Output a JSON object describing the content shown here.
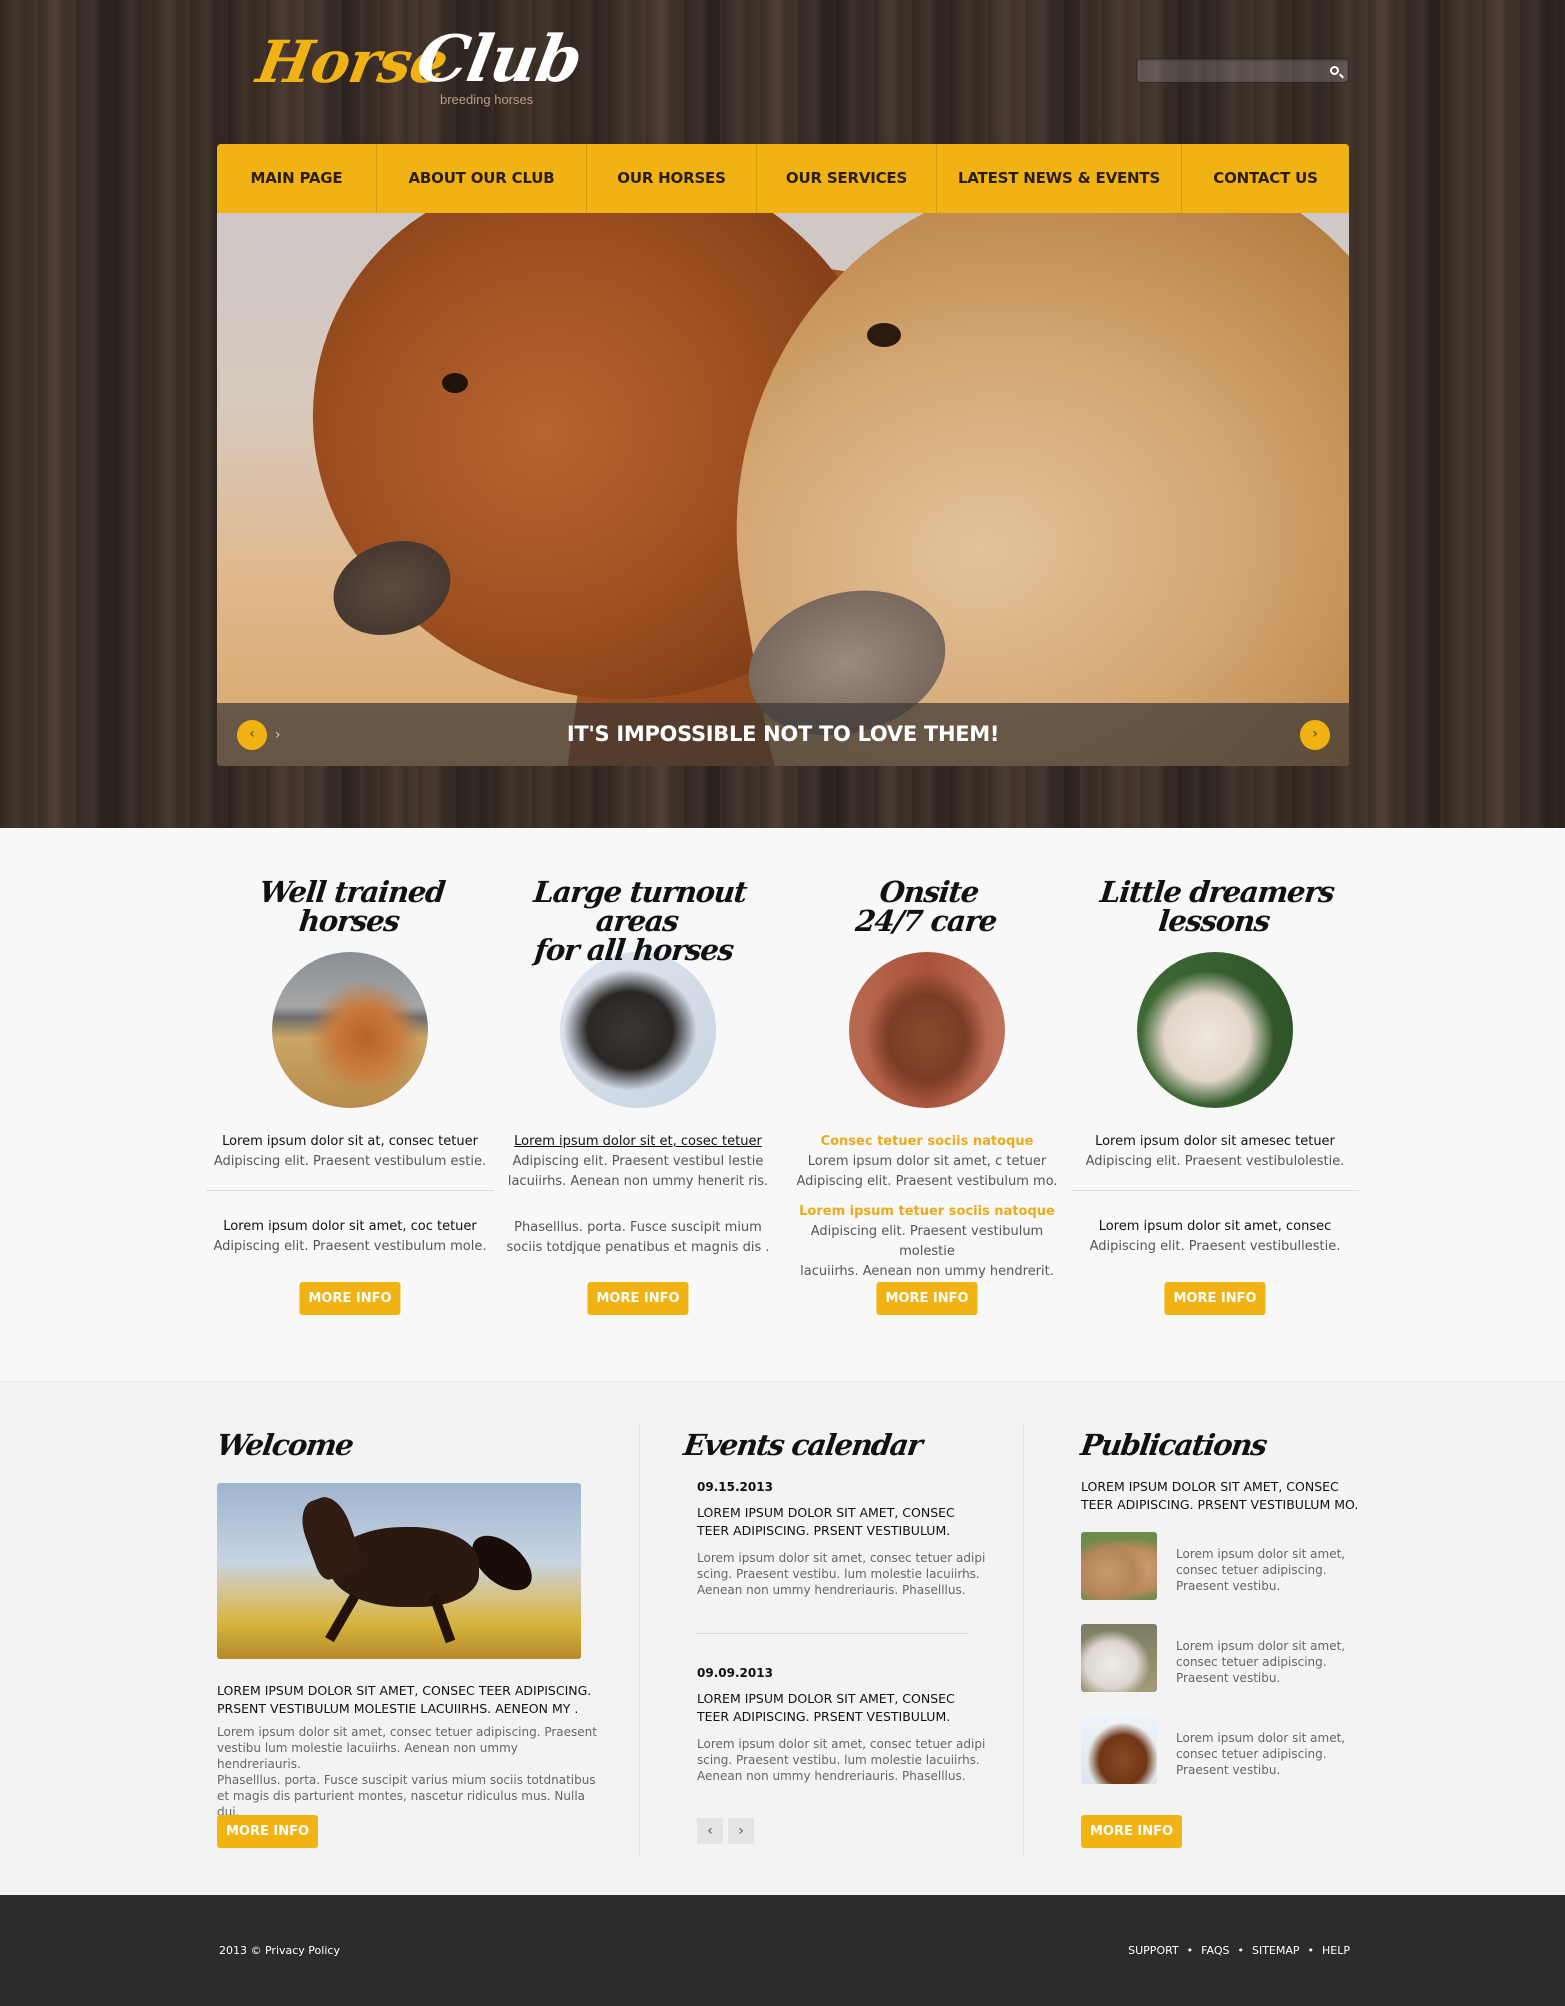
{
  "brand": {
    "name_part1": "Horse",
    "name_part2": "Club",
    "tagline": "breeding horses",
    "accent_color": "#f1b314"
  },
  "search": {
    "placeholder": "",
    "value": "",
    "icon": "search-icon"
  },
  "nav": {
    "items": [
      {
        "label": "MAIN PAGE"
      },
      {
        "label": "ABOUT OUR CLUB"
      },
      {
        "label": "OUR HORSES"
      },
      {
        "label": "OUR SERVICES"
      },
      {
        "label": "LATEST NEWS & EVENTS"
      },
      {
        "label": "CONTACT US"
      }
    ]
  },
  "slider": {
    "caption": "IT'S IMPOSSIBLE NOT TO LOVE THEM!",
    "prev_icon": "‹",
    "next_icon": "›"
  },
  "features": [
    {
      "title_line1": "Well trained",
      "title_line2": "horses",
      "image": "horse-laughing-photo",
      "blocks": [
        {
          "lead": "Lorem ipsum dolor sit at, consec tetuer",
          "text": "Adipiscing elit. Praesent vestibulum estie."
        },
        {
          "lead": "Lorem ipsum dolor sit amet, coc tetuer",
          "text": "Adipiscing elit. Praesent vestibulum mole."
        }
      ],
      "button": "MORE INFO"
    },
    {
      "title_line1": "Large turnout areas",
      "title_line2": "for all horses",
      "image": "black-horse-photo",
      "blocks": [
        {
          "lead": "Lorem ipsum dolor sit et, cosec tetuer",
          "text1": "Adipiscing elit. Praesent vestibul lestie",
          "text2": "lacuiirhs. Aenean non ummy henerit ris."
        },
        {
          "text1": "Phaselllus. porta. Fusce suscipit  mium",
          "text2": "sociis totdjque penatibus et magnis dis ."
        }
      ],
      "button": "MORE INFO"
    },
    {
      "title_line1": "Onsite",
      "title_line2": "24/7 care",
      "image": "bay-horse-halter-photo",
      "blocks": [
        {
          "lead": "Consec tetuer sociis natoque",
          "text1": "Lorem ipsum dolor sit amet, c tetuer",
          "text2": "Adipiscing elit. Praesent vestibulum mo."
        },
        {
          "lead": "Lorem ipsum tetuer sociis natoque",
          "text1": "Adipiscing elit. Praesent vestibulum molestie",
          "text2": "lacuiirhs. Aenean non ummy hendrerit."
        }
      ],
      "button": "MORE INFO"
    },
    {
      "title_line1": "Little dreamers",
      "title_line2": "lessons",
      "image": "white-horse-photo",
      "blocks": [
        {
          "lead": "Lorem ipsum dolor sit amesec tetuer",
          "text": "Adipiscing elit. Praesent vestibulolestie."
        },
        {
          "lead": "Lorem ipsum dolor sit amet, consec",
          "text": "Adipiscing elit. Praesent vestibullestie."
        }
      ],
      "button": "MORE INFO"
    }
  ],
  "welcome": {
    "title": "Welcome",
    "heading_line1": "LOREM IPSUM DOLOR SIT AMET, CONSEC TEER ADIPISCING.",
    "heading_line2": "PRSENT VESTIBULUM MOLESTIE LACUIIRHS. AENEON MY .",
    "body": [
      "Lorem ipsum dolor sit amet, consec tetuer adipiscing. Praesent",
      "vestibu lum molestie lacuiirhs. Aenean non ummy hendreriauris.",
      "Phaselllus. porta. Fusce suscipit varius mium sociis totdnatibus",
      "et magis dis parturient montes, nascetur ridiculus mus. Nulla dui."
    ],
    "button": "MORE INFO"
  },
  "events": {
    "title": "Events calendar",
    "items": [
      {
        "date": "09.15.2013",
        "heading_line1": "LOREM IPSUM DOLOR SIT AMET, CONSEC",
        "heading_line2": "TEER ADIPISCING. PRSENT VESTIBULUM.",
        "body": [
          "Lorem ipsum dolor sit amet, consec tetuer adipi",
          "scing. Praesent vestibu.  lum molestie lacuiirhs.",
          "Aenean non ummy hendreriauris. Phaselllus."
        ]
      },
      {
        "date": "09.09.2013",
        "heading_line1": "LOREM IPSUM DOLOR SIT AMET, CONSEC",
        "heading_line2": "TEER ADIPISCING. PRSENT VESTIBULUM.",
        "body": [
          "Lorem ipsum dolor sit amet, consec tetuer adipi",
          "scing. Praesent vestibu.  lum molestie lacuiirhs.",
          "Aenean non ummy hendreriauris. Phaselllus."
        ]
      }
    ],
    "prev_icon": "‹",
    "next_icon": "›"
  },
  "publications": {
    "title": "Publications",
    "heading_line1": "LOREM IPSUM DOLOR SIT AMET, CONSEC",
    "heading_line2": "TEER ADIPISCING. PRSENT VESTIBULUM MO.",
    "items": [
      {
        "image": "two-ponies-photo",
        "lines": [
          "Lorem ipsum dolor sit amet,",
          "consec tetuer adipiscing.",
          "Praesent vestibu."
        ]
      },
      {
        "image": "white-horses-photo",
        "lines": [
          "Lorem ipsum dolor sit amet,",
          "consec tetuer adipiscing.",
          "Praesent vestibu."
        ]
      },
      {
        "image": "bay-horse-running-photo",
        "lines": [
          "Lorem ipsum dolor sit amet,",
          "consec tetuer adipiscing.",
          "Praesent vestibu."
        ]
      }
    ],
    "button": "MORE INFO"
  },
  "footer": {
    "copyright": "2013 © Privacy Policy",
    "links": [
      "SUPPORT",
      "FAQS",
      "SITEMAP",
      "HELP"
    ],
    "separator": "•"
  }
}
